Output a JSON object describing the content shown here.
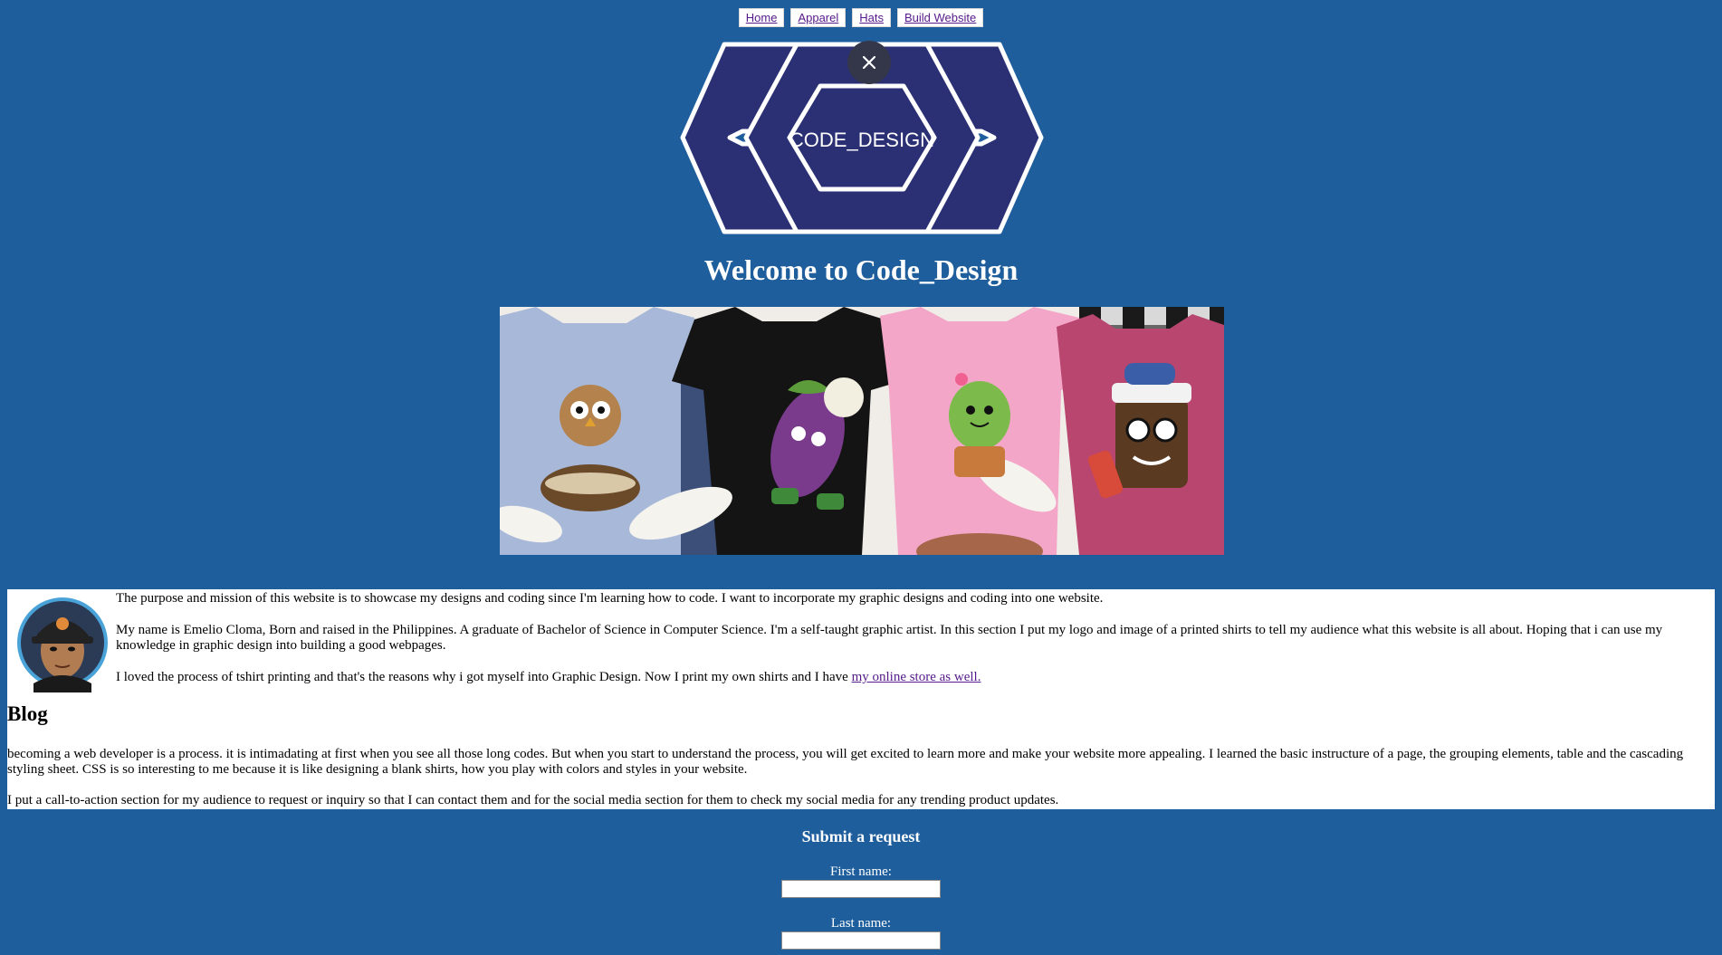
{
  "nav": {
    "items": [
      {
        "label": "Home"
      },
      {
        "label": "Apparel"
      },
      {
        "label": "Hats"
      },
      {
        "label": "Build Website"
      }
    ]
  },
  "logo": {
    "text": "CODE_DESIGN",
    "colors": {
      "fill": "#2b3075",
      "outline": "#ffffff"
    }
  },
  "close_icon": "close-icon",
  "welcome": {
    "title": "Welcome to Code_Design"
  },
  "hero": {
    "alt": "t-shirts banner"
  },
  "about": {
    "paragraphs": {
      "p1": "The purpose and mission of this website is to showcase my designs and coding since I'm learning how to code. I want to incorporate my graphic designs and coding into one website.",
      "p2": "My name is Emelio Cloma, Born and raised in the Philippines. A graduate of Bachelor of Science in Computer Science. I'm a self-taught graphic artist. In this section I put my logo and image of a printed shirts to tell my audience what this website is all about. Hoping that i can use my knowledge in graphic design into building a good webpages.",
      "p3_text": "I loved the process of tshirt printing and that's the reasons why i got myself into Graphic Design. Now I print my own shirts and I have ",
      "p3_link": "my online store as well."
    }
  },
  "blog": {
    "title": "Blog",
    "p1": "becoming a web developer is a process. it is intimadating at first when you see all those long codes. But when you start to understand the process, you will get excited to learn more and make your website more appealing. I learned the basic instructure of a page, the grouping elements, table and the cascading styling sheet. CSS is so interesting to me because it is like designing a blank shirts, how you play with colors and styles in your website.",
    "p2": "I put a call-to-action section for my audience to request or inquiry so that I can contact them and for the social media section for them to check my social media for any trending product updates."
  },
  "form": {
    "title": "Submit a request",
    "first_name_label": "First name:",
    "first_name_value": "",
    "last_name_label": "Last name:",
    "last_name_value": ""
  },
  "colors": {
    "page_background": "#1f5e9c",
    "link": "#551a8b"
  }
}
